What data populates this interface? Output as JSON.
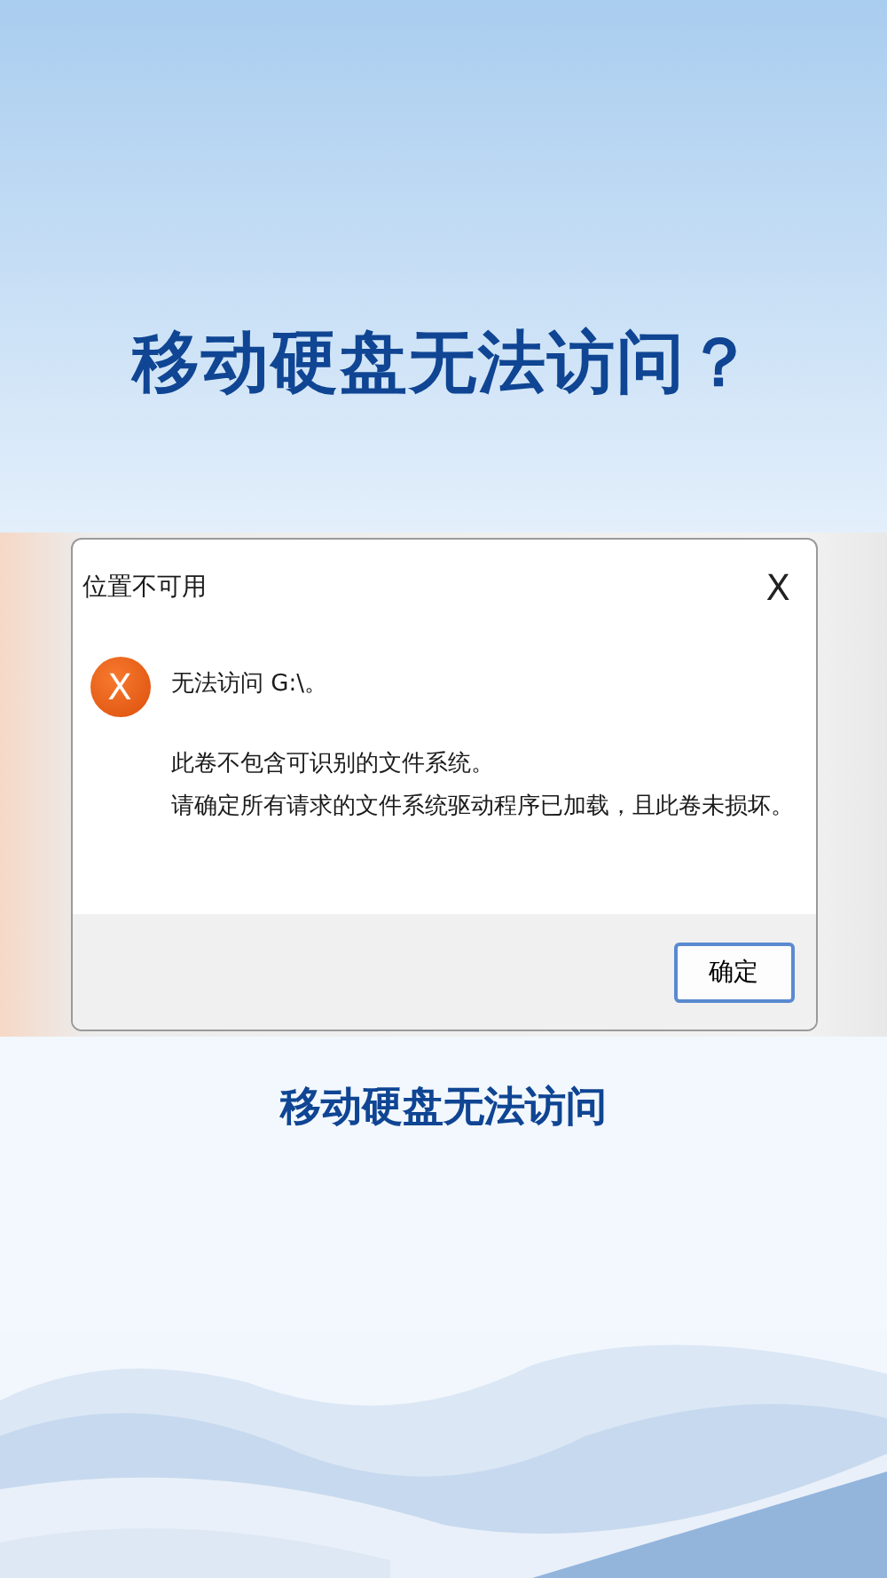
{
  "headline": "移动硬盘无法访问？",
  "dialog": {
    "title": "位置不可用",
    "close": "X",
    "icon": "X",
    "message": "无法访问 G:\\。",
    "details": [
      "此卷不包含可识别的文件系统。",
      "请确定所有请求的文件系统驱动程序已加载，且此卷未损坏。"
    ],
    "buttons": [
      "确定"
    ]
  },
  "subtitle": "移动硬盘无法访问"
}
